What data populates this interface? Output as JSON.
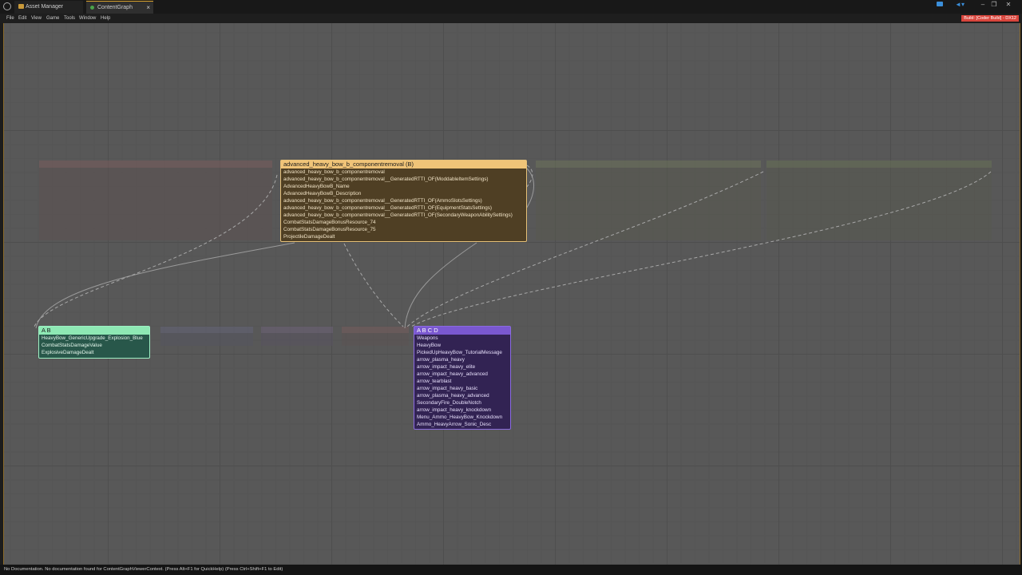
{
  "tabs": [
    {
      "label": "Asset Manager"
    },
    {
      "label": "ContentGraph",
      "close": "×"
    }
  ],
  "window_controls": {
    "share": "◄▾",
    "minimize": "–",
    "restore": "❐",
    "close": "✕"
  },
  "menu": [
    "File",
    "Edit",
    "View",
    "Game",
    "Tools",
    "Window",
    "Help"
  ],
  "build_badge": "Build: [Coder Build] - DX12",
  "nodes": {
    "main": {
      "title": "advanced_heavy_bow_b_componentremoval (B)",
      "rows": [
        "advanced_heavy_bow_b_componentremoval",
        "advanced_heavy_bow_b_componentremoval__GeneratedRTTI_OF(ModdableItemSettings)",
        "AdvancedHeavyBowB_Name",
        "AdvancedHeavyBowB_Description",
        "advanced_heavy_bow_b_componentremoval__GeneratedRTTI_OF(AmmoSlotsSettings)",
        "advanced_heavy_bow_b_componentremoval__GeneratedRTTI_OF(EquipmentStatsSettings)",
        "advanced_heavy_bow_b_componentremoval__GeneratedRTTI_OF(SecondaryWeaponAbilitySettings)",
        "CombatStatsDamageBonusResource_74",
        "CombatStatsDamageBonusResource_75",
        "ProjectileDamageDealt"
      ]
    },
    "ab": {
      "title": "A B",
      "rows": [
        "HeavyBow_GenericUpgrade_Explosion_Blue",
        "CombatStatsDamageValue",
        "ExplosiveDamageDealt"
      ]
    },
    "abcd": {
      "title": "A B C D",
      "rows": [
        "Weapons",
        "HeavyBow",
        "PickedUpHeavyBow_TutorialMessage",
        "arrow_plasma_heavy",
        "arrow_impact_heavy_elite",
        "arrow_impact_heavy_advanced",
        "arrow_tearblast",
        "arrow_impact_heavy_basic",
        "arrow_plasma_heavy_advanced",
        "SecondaryFire_DoubleNotch",
        "arrow_impact_heavy_knockdown",
        "Menu_Ammo_HeavyBow_Knockdown",
        "Ammo_HeavyArrow_Sonic_Desc"
      ]
    }
  },
  "status": "No Documentation. No documentation found for ContentGraphViewerContext. (Press Alt+F1 for QuickHelp) (Press Ctrl+Shift+F1 to Edit)",
  "colors": {
    "main_node": "#f0c478",
    "ab_node": "#8ee8b4",
    "abcd_node": "#7a58d0",
    "build_badge": "#d9453c",
    "accent": "#d9a22d"
  }
}
